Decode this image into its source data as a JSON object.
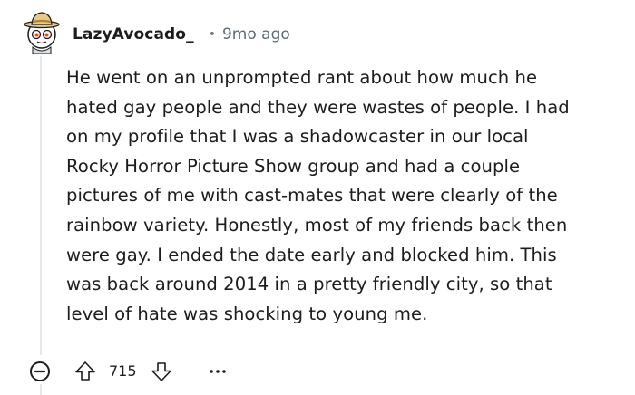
{
  "comment": {
    "author": "LazyAvocado_",
    "separator": "•",
    "timestamp": "9mo ago",
    "body_lines": [
      "He went on an unprompted rant about how much he",
      "hated gay people and they were wastes of people. I had",
      "on my profile that I was a shadowcaster in our local",
      "Rocky Horror Picture Show group and had a couple",
      "pictures of me with cast-mates that were clearly of the",
      "rainbow variety. Honestly, most of my friends back then",
      "were gay. I ended the date early and blocked him. This",
      "was back around 2014 in a pretty friendly city, so that",
      "level of hate was shocking to young me."
    ],
    "score": "715",
    "more_label": "•••"
  },
  "icons": {
    "avatar": "avatar-icon",
    "collapse": "collapse-minus-icon",
    "upvote": "upvote-arrow-icon",
    "downvote": "downvote-arrow-icon",
    "more": "more-options-icon"
  },
  "colors": {
    "text": "#1c1c1c",
    "meta": "#5c6c74",
    "thread_line": "#e3e7ea",
    "avatar_bg": "#d9e1e6"
  }
}
